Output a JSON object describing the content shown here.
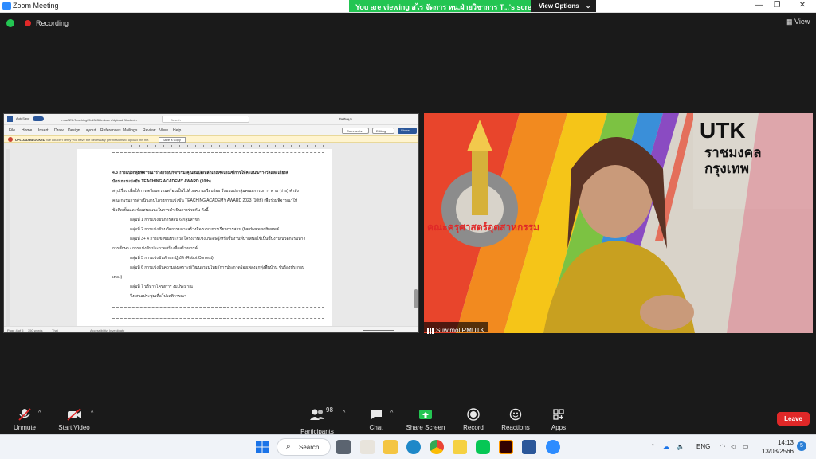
{
  "window": {
    "title": "Zoom Meeting"
  },
  "banner": {
    "viewing_text": "You are viewing สไร จัดการ หน.ฝ่ายวิชาการ T...'s screen",
    "view_options_label": "View Options"
  },
  "topbar": {
    "recording_label": "Recording",
    "view_label": "View"
  },
  "word": {
    "autosave_label": "AutoSave",
    "toggle_label": "On",
    "filename": "~rma/เทพ-Teaching25-13036k.docx • Upload Blocked •",
    "search_placeholder": "Search",
    "user": "ชัชชัทคุณ",
    "tabs": [
      "File",
      "Home",
      "Insert",
      "Draw",
      "Design",
      "Layout",
      "References",
      "Mailings",
      "Review",
      "View",
      "Help"
    ],
    "comments_label": "Comments",
    "editing_label": "Editing",
    "share_label": "Share",
    "upload_label": "UPLOAD BLOCKED",
    "upload_message": "We couldn't verify you have the necessary permissions to upload this file.",
    "save_copy_label": "Save a Copy",
    "doc_lines": [
      "4.3 การแบ่งกลุ่มพิจารณาร่างกรอบกิจกรรม/คุณสมบัติ/หลักเกณฑ์/เกณฑ์การให้คะแนน/รางวัลและเกียรติ",
      "บัตร การแข่งขัน TEACHING ACADEMY AWARD (10th)",
      "สรุปเรื่อง เพื่อให้การเตรียมความพร้อมเป็นไปด้วยความเรียบร้อย จึงขอแบ่งกลุ่มคณะกรรมการ ตาม (ร่าง) คำสั่ง",
      "คณะกรรมการดำเนินงานโครงการแข่งขัน TEACHING ACADEMY AWARD 2023 (10th) เพื่อร่วมพิจารณาให้",
      "ข้อคิดเห็นและข้อเสนอแนะในการดำเนินการร่วมกัน ดังนี้",
      "กลุ่มที่ 1 การแข่งขันการสอน 6 กลุ่มสาขา",
      "กลุ่มที่ 2 การแข่งขันนวัตกรรมการสร้างสื่อ/ระบบการเรียนการสอน (hardware/softwareX",
      "กลุ่มที่ 3+ 4 การแข่งขันประกวดโครงงานเชิงประดิษฐ์/หรือชิ้นงานที่นำเสนอใช้เป็นชิ้นงาน/นวัตกรรมทาง",
      "การศึกษา / การแข่งขันประกวดสร้างสื่อสร้างสรรค์",
      "กลุ่มที่ 5 การแข่งขันทักษะปฏิบัติ   (Robot Contest)",
      "กลุ่มที่ 6 การแข่งขันความสงเคราะห์/วัฒนธรรมไทย (การประกวดร้องเพลงลูกทุ่งพื้นบ้าน ขับร้องประกอบ",
      "เพลง)",
      "กลุ่มที่ 7 บริหารโครงการ งบประมาณ",
      "จึงเสนอประชุมเพื่อโปรดพิจารณา"
    ],
    "status_page": "Page 4 of 5",
    "status_words": "350 words",
    "status_lang": "Thai",
    "status_access": "Accessibility: Investigate"
  },
  "video": {
    "participant_name": "Suwimol RMUTK",
    "logo_text": "UTK",
    "logo_line1": "ราชมงคล",
    "logo_line2": "กรุงเทพ",
    "faculty_text": "คณะครุศาสตร์อุตสาหกรรม"
  },
  "toolbar": {
    "unmute": "Unmute",
    "start_video": "Start Video",
    "participants_count": "98",
    "participants": "Participants",
    "chat": "Chat",
    "share_screen": "Share Screen",
    "record": "Record",
    "reactions": "Reactions",
    "apps": "Apps",
    "leave": "Leave"
  },
  "taskbar": {
    "search_label": "Search",
    "lang": "ENG",
    "time": "14:13",
    "date": "13/03/2566",
    "notification_count": "5"
  },
  "colors": {
    "zoom_green": "#23c552",
    "leave_red": "#e02828",
    "word_blue": "#2b579a"
  }
}
